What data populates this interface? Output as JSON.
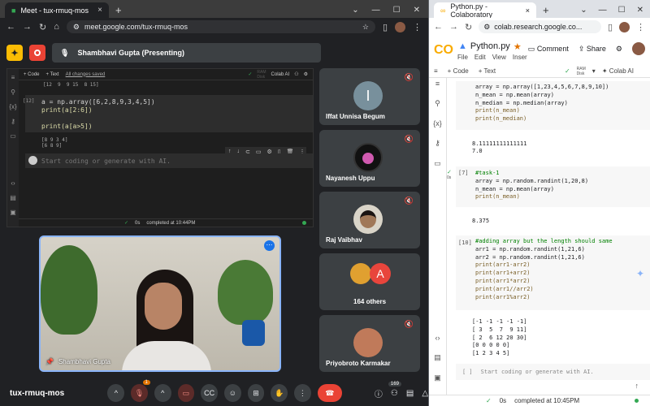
{
  "meet_browser": {
    "tab_title": "Meet - tux-rmuq-mos",
    "url": "meet.google.com/tux-rmuq-mos",
    "presenter_label": "Shambhavi Gupta (Presenting)",
    "presented_screen": {
      "toolbar": [
        "+ Code",
        "+ Text"
      ],
      "saved_label": "All changes saved",
      "ram_label": "RAM",
      "disk_label": "Disk",
      "colab_ai_label": "Colab AI",
      "prev_output": "[12  9  9 15  8 15]",
      "exec_count": "[12]",
      "code_lines": [
        "a = np.array([6,2,8,9,3,4,5])",
        "print(a[2:6])",
        "",
        "print(a[a>5])"
      ],
      "output_lines": [
        "[8 9 3 4]",
        "[6 8 9]"
      ],
      "empty_cell_text": "Start coding or generate with AI.",
      "status_time": "0s",
      "status_text": "completed at 10:44PM"
    },
    "self_view_name": "Shambhavi Gupta",
    "participants": [
      {
        "name": "Iffat Unnisa Begum",
        "initial": "I",
        "color": "#78909c"
      },
      {
        "name": "Nayanesh Uppu",
        "initial": "",
        "color": "#111111"
      },
      {
        "name": "Raj Vaibhav",
        "initial": "",
        "color": "#d9d4c8"
      },
      {
        "name": "164 others",
        "initial": "A",
        "color": "#e8453c"
      },
      {
        "name": "Priyobroto Karmakar",
        "initial": "",
        "color": "#c07a5a"
      }
    ],
    "meeting_code": "tux-rmuq-mos",
    "raise_count": "1",
    "participants_count": "169"
  },
  "colab_browser": {
    "tab_title": "Python.py - Colaboratory",
    "url": "colab.research.google.co...",
    "file_name": "Python.py",
    "menu": [
      "File",
      "Edit",
      "View",
      "Inser"
    ],
    "comment_label": "Comment",
    "share_label": "Share",
    "toolbar": [
      "+ Code",
      "+ Text"
    ],
    "ram_label": "RAM",
    "disk_label": "Disk",
    "colab_ai_label": "Colab AI",
    "cells": [
      {
        "exec": "",
        "code": [
          "array = np.array([1,23,4,5,6,7,8,9,10])",
          "n_mean = np.mean(array)",
          "n_median = np.median(array)",
          "print(n_mean)",
          "print(n_median)"
        ],
        "output": [
          "8.11111111111111",
          "7.0"
        ]
      },
      {
        "exec": "[7]",
        "exec_time": "0s",
        "code": [
          "#task-1",
          "array = np.random.randint(1,20,8)",
          "n_mean = np.mean(array)",
          "print(n_mean)"
        ],
        "output": [
          "8.375"
        ]
      },
      {
        "exec": "[10]",
        "code": [
          "#adding array but the length should same",
          "arr1 = np.random.randint(1,21,6)",
          "arr2 = np.random.randint(1,21,6)",
          "print(arr1-arr2)",
          "print(arr1+arr2)",
          "print(arr1*arr2)",
          "print(arr1//arr2)",
          "print(arr1%arr2)"
        ],
        "output": [
          "[-1 -1 -1 -1 -1]",
          "[ 3  5  7  9 11]",
          "[ 2  6 12 20 30]",
          "[0 0 0 0 0]",
          "[1 2 3 4 5]"
        ]
      }
    ],
    "empty_cell_exec": "[ ]",
    "empty_cell_text": "Start coding or generate with AI.",
    "status_time": "0s",
    "status_text": "completed at 10:45PM"
  }
}
